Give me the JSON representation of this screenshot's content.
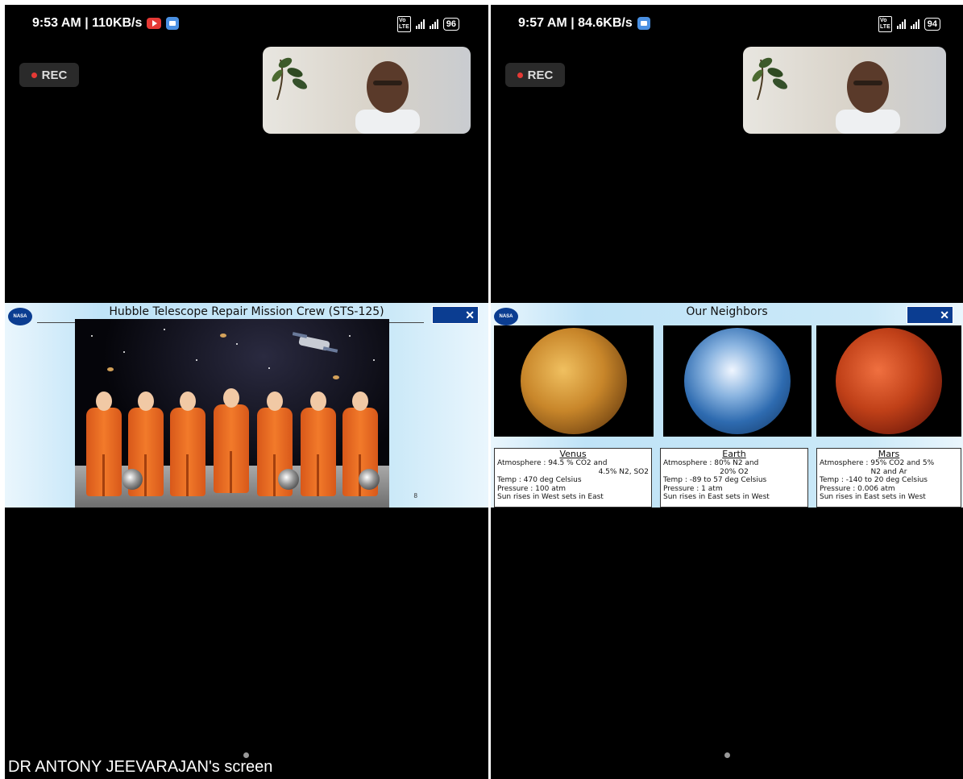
{
  "left": {
    "status": {
      "time": "9:53 AM | 110KB/s",
      "battery": "96"
    },
    "rec_label": "REC",
    "slide": {
      "title": "Hubble Telescope Repair Mission Crew (STS-125)",
      "nasa_logo": "NASA",
      "page_number": "8"
    },
    "screen_owner": "DR ANTONY JEEVARAJAN's screen"
  },
  "right": {
    "status": {
      "time": "9:57 AM | 84.6KB/s",
      "battery": "94"
    },
    "rec_label": "REC",
    "slide": {
      "title": "Our Neighbors",
      "nasa_logo": "NASA",
      "planets": [
        {
          "name": "Venus",
          "lines": [
            "Atmosphere : 94.5 % CO2 and",
            "4.5% N2, SO2",
            "Temp : 470 deg Celsius",
            "Pressure : 100 atm",
            "Sun rises in West sets in East"
          ]
        },
        {
          "name": "Earth",
          "lines": [
            "Atmosphere : 80% N2 and",
            "20% O2",
            "Temp : -89 to 57 deg Celsius",
            "Pressure : 1 atm",
            "Sun rises in East sets in West"
          ]
        },
        {
          "name": "Mars",
          "lines": [
            "Atmosphere : 95% CO2 and 5%",
            "N2 and Ar",
            "Temp : -140 to 20 deg Celsius",
            "Pressure : 0.006 atm",
            "Sun rises in East sets in West"
          ]
        }
      ]
    }
  },
  "colors": {
    "rec_dot": "#e53935",
    "slide_bg": "#cbe9f8",
    "astronaut_suit": "#f27a2a"
  },
  "icons": [
    "youtube-icon",
    "meet-icon",
    "volte-icon",
    "signal-icon",
    "battery-icon",
    "record-dot-icon"
  ]
}
